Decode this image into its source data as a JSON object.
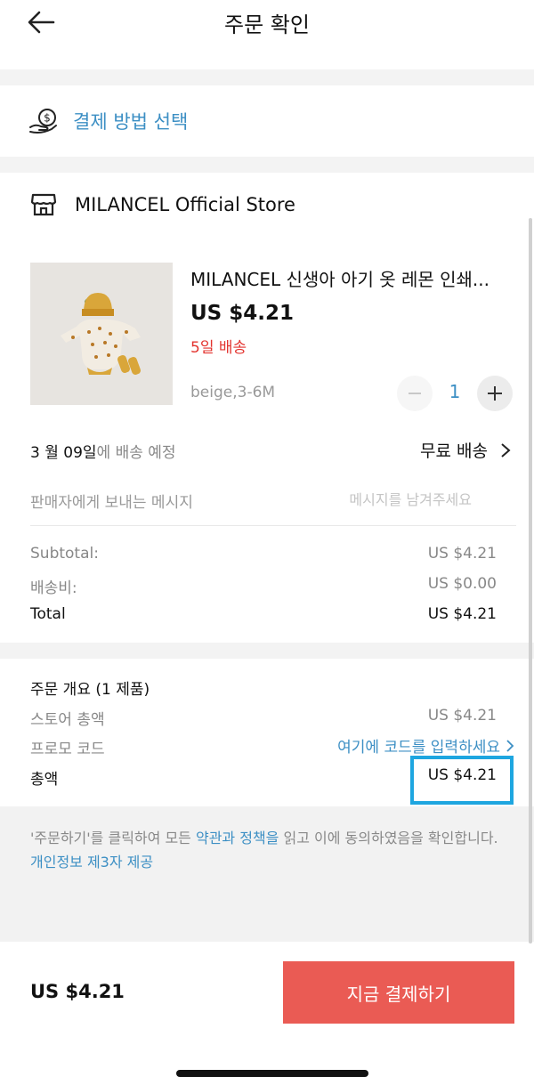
{
  "header": {
    "title": "주문 확인"
  },
  "payment": {
    "label": "결제 방법 선택"
  },
  "store": {
    "name": "MILANCEL Official Store",
    "product": {
      "title": "MILANCEL 신생아 아기 옷 레몬 인쇄...",
      "price": "US $4.21",
      "delivery_days": "5일 배송",
      "variant": "beige,3-6M",
      "quantity": "1"
    },
    "shipping": {
      "date_strong": "3 월 09일",
      "date_suffix": "에 배송 예정",
      "method": "무료 배송"
    },
    "message": {
      "label": "판매자에게 보내는 메시지",
      "placeholder": "메시지를 남겨주세요"
    },
    "summary": {
      "subtotal_label": "Subtotal:",
      "subtotal_value": "US $4.21",
      "shipping_label": "배송비:",
      "shipping_value": "US $0.00",
      "total_label": "Total",
      "total_value": "US $4.21"
    }
  },
  "order_summary": {
    "title": "주문 개요 (1 제품)",
    "store_total_label": "스토어 총액",
    "store_total_value": "US $4.21",
    "promo_label": "프로모 코드",
    "promo_link": "여기에 코드를 입력하세요",
    "grand_total_label": "총액",
    "grand_total_value": "US $4.21"
  },
  "terms": {
    "prefix": "'주문하기'를 클릭하여 모든 ",
    "link": "약관과 정책을",
    "suffix": " 읽고 이에 동의하였음을 확인합니다.",
    "privacy_link": "개인정보 제3자 제공"
  },
  "bottom": {
    "total": "US $4.21",
    "pay_button": "지금 결제하기"
  },
  "colors": {
    "accent_blue": "#3c8fc4",
    "pay_red": "#ea5b54",
    "highlight_cyan": "#1ea6e0",
    "delivery_red": "#e3342f"
  }
}
